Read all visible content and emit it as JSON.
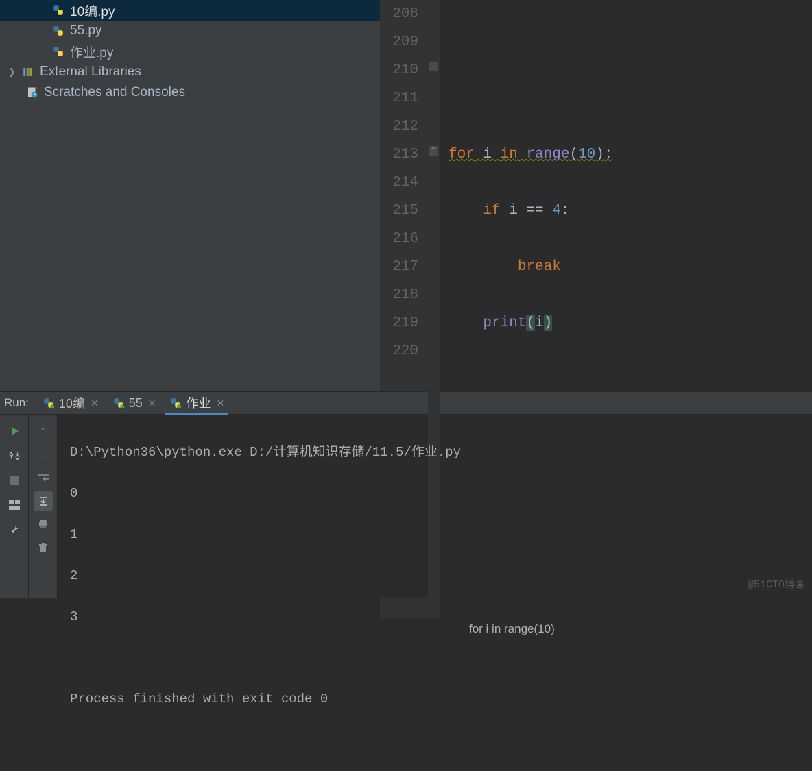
{
  "sidebar": {
    "files": [
      {
        "name": "10编.py",
        "selected": true
      },
      {
        "name": "55.py",
        "selected": false
      },
      {
        "name": "作业.py",
        "selected": false
      }
    ],
    "external_libraries_label": "External Libraries",
    "scratches_label": "Scratches and Consoles"
  },
  "editor": {
    "line_numbers": [
      "208",
      "209",
      "210",
      "211",
      "212",
      "213",
      "214",
      "215",
      "216",
      "217",
      "218",
      "219",
      "220"
    ],
    "code": {
      "l210_for": "for",
      "l210_var": " i ",
      "l210_in": "in",
      "l210_range": " range",
      "l210_open": "(",
      "l210_num": "10",
      "l210_close": ")",
      "l210_colon": ":",
      "l211_if": "if",
      "l211_rest": " i == ",
      "l211_num": "4",
      "l211_colon": ":",
      "l212_break": "break",
      "l213_print": "print",
      "l213_open": "(",
      "l213_i": "i",
      "l213_close": ")"
    },
    "breadcrumb": "for i in range(10)"
  },
  "run": {
    "label": "Run:",
    "tabs": [
      {
        "name": "10编",
        "active": false
      },
      {
        "name": "55",
        "active": false
      },
      {
        "name": "作业",
        "active": true
      }
    ]
  },
  "console": {
    "cmd": "D:\\Python36\\python.exe D:/计算机知识存储/11.5/作业.py",
    "out": [
      "0",
      "1",
      "2",
      "3"
    ],
    "exit": "Process finished with exit code 0"
  },
  "watermark": "@51CTO博客"
}
